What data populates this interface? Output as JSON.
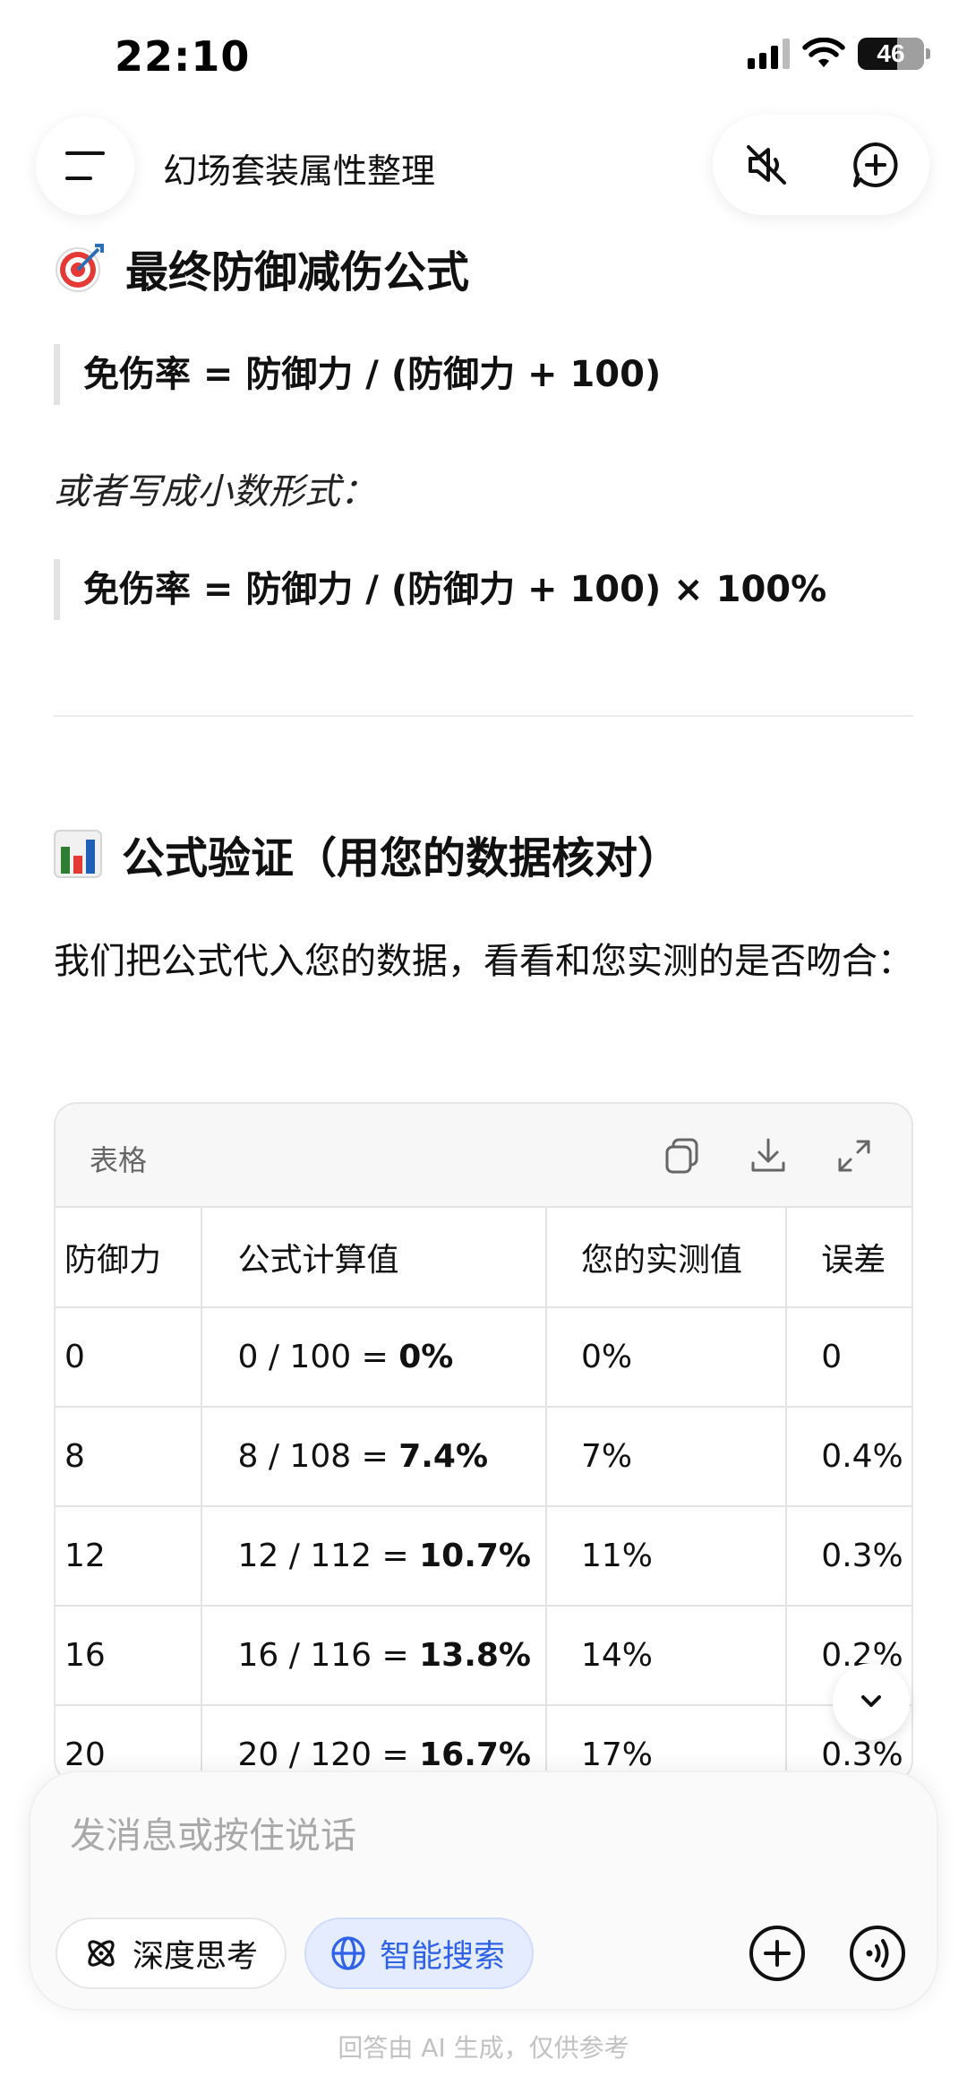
{
  "status_bar": {
    "time": "22:10",
    "battery": "46"
  },
  "header": {
    "title": "幻场套装属性整理"
  },
  "section1": {
    "heading": "最终防御减伤公式",
    "formula1": "免伤率 = 防御力 / (防御力 + 100)",
    "alt_text": "或者写成小数形式：",
    "formula2": "免伤率 = 防御力 / (防御力 + 100) × 100%"
  },
  "section2": {
    "heading": "公式验证（用您的数据核对）",
    "intro": "我们把公式代入您的数据，看看和您实测的是否吻合："
  },
  "table": {
    "label": "表格",
    "headers": [
      "防御力",
      "公式计算值",
      "您的实测值",
      "误差"
    ],
    "rows": [
      {
        "def": "0",
        "calc_prefix": "0 / 100 = ",
        "calc_result": "0%",
        "measured": "0%",
        "error": "0"
      },
      {
        "def": "8",
        "calc_prefix": "8 / 108 = ",
        "calc_result": "7.4%",
        "measured": "7%",
        "error": "0.4%"
      },
      {
        "def": "12",
        "calc_prefix": "12 / 112 = ",
        "calc_result": "10.7%",
        "measured": "11%",
        "error": "0.3%"
      },
      {
        "def": "16",
        "calc_prefix": "16 / 116 = ",
        "calc_result": "13.8%",
        "measured": "14%",
        "error": "0.2%"
      },
      {
        "def": "20",
        "calc_prefix": "20 / 120 = ",
        "calc_result": "16.7%",
        "measured": "17%",
        "error": "0.3%"
      }
    ]
  },
  "composer": {
    "placeholder": "发消息或按住说话",
    "deep_think_label": "深度思考",
    "smart_search_label": "智能搜索"
  },
  "footer": {
    "disclaimer": "回答由 AI 生成，仅供参考"
  },
  "colors": {
    "accent_blue": "#2f62e8",
    "chip_blue_bg": "#e4ecfd"
  },
  "icons": [
    "menu-icon",
    "mute-icon",
    "new-chat-icon",
    "target-icon",
    "bar-chart-icon",
    "copy-icon",
    "download-icon",
    "expand-icon",
    "chevron-down-icon",
    "deep-think-icon",
    "globe-icon",
    "plus-icon",
    "voice-icon"
  ]
}
